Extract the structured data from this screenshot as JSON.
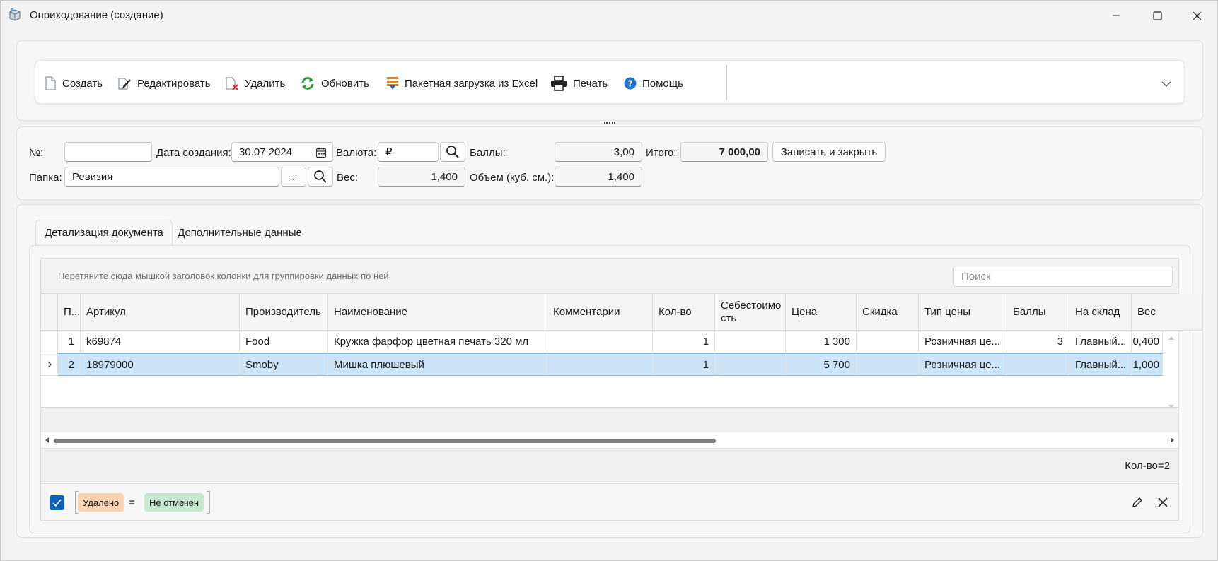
{
  "window": {
    "title": "Оприходование (создание)"
  },
  "toolbar": {
    "create": "Создать",
    "edit": "Редактировать",
    "delete": "Удалить",
    "refresh": "Обновить",
    "import_excel": "Пакетная загрузка из Excel",
    "print": "Печать",
    "help": "Помощь"
  },
  "form": {
    "number_label": "№:",
    "number_value": "",
    "date_label": "Дата создания:",
    "date_value": "30.07.2024",
    "currency_label": "Валюта:",
    "currency_value": "₽",
    "points_label": "Баллы:",
    "points_value": "3,00",
    "total_label": "Итого:",
    "total_value": "7 000,00",
    "save_close": "Записать и закрыть",
    "folder_label": "Папка:",
    "folder_value": "Ревизия",
    "folder_browse": "...",
    "weight_label": "Вес:",
    "weight_value": "1,400",
    "volume_label": "Объем (куб. см.):",
    "volume_value": "1,400"
  },
  "tabs": [
    {
      "label": "Детализация документа",
      "active": true
    },
    {
      "label": "Дополнительные данные",
      "active": false
    }
  ],
  "grid": {
    "group_hint": "Перетяните сюда мышкой заголовок колонки для группировки данных по ней",
    "search_placeholder": "Поиск",
    "columns": [
      "П...",
      "Артикул",
      "Производитель",
      "Наименование",
      "Комментарии",
      "Кол-во",
      "Себестоимо сть",
      "Цена",
      "Скидка",
      "Тип цены",
      "Баллы",
      "На склад",
      "Вес"
    ],
    "rows": [
      [
        "1",
        "k69874",
        "Food",
        "Кружка фарфор цветная печать 320 мл",
        "",
        "1",
        "",
        "1 300",
        "",
        "Розничная це...",
        "3",
        "Главный...",
        "0,400"
      ],
      [
        "2",
        "18979000",
        "Smoby",
        "Мишка плюшевый",
        "",
        "1",
        "",
        "5 700",
        "",
        "Розничная це...",
        "",
        "Главный...",
        "1,000"
      ]
    ],
    "selected_row": 1,
    "count": "Кол-во=2"
  },
  "filter": {
    "enabled": true,
    "field": "Удалено",
    "operator": "=",
    "value": "Не отмечен"
  },
  "colors": {
    "accent": "#1060b8",
    "selection": "#cce4f7",
    "chip_field": "#f8d3b0",
    "chip_value": "#c5e8cf",
    "icon_green": "#2e9e3e",
    "icon_orange": "#e8801c",
    "icon_blue": "#1a73c9"
  }
}
